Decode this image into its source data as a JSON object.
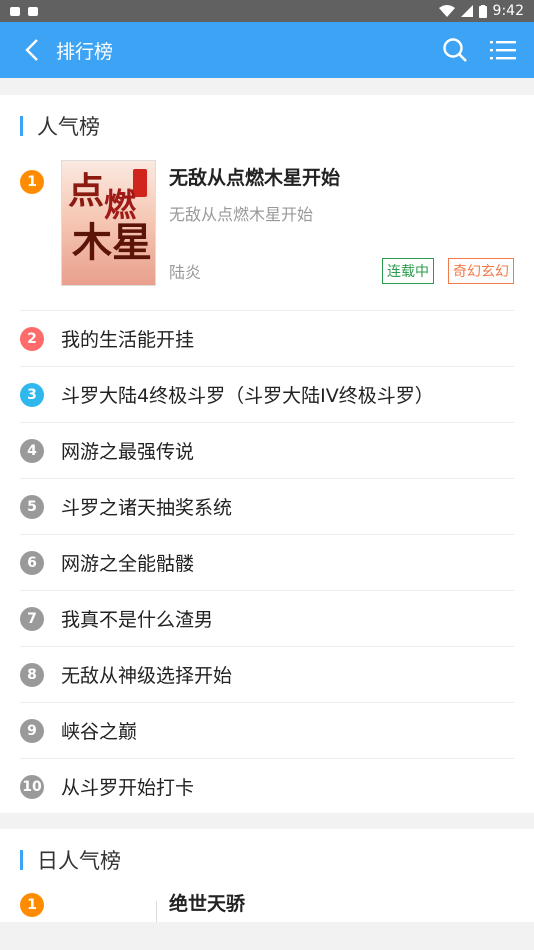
{
  "status": {
    "time": "9:42"
  },
  "appbar": {
    "title": "排行榜"
  },
  "section1": {
    "title": "人气榜",
    "top": {
      "rank": "1",
      "title": "无敌从点燃木星开始",
      "subtitle": "无敌从点燃木星开始",
      "author": "陆炎",
      "status": "连载中",
      "genre": "奇幻玄幻",
      "cover_text": [
        "点",
        "燃",
        "木星"
      ]
    },
    "items": [
      {
        "rank": "2",
        "title": "我的生活能开挂"
      },
      {
        "rank": "3",
        "title": "斗罗大陆4终极斗罗（斗罗大陆IV终极斗罗）"
      },
      {
        "rank": "4",
        "title": "网游之最强传说"
      },
      {
        "rank": "5",
        "title": "斗罗之诸天抽奖系统"
      },
      {
        "rank": "6",
        "title": "网游之全能骷髅"
      },
      {
        "rank": "7",
        "title": "我真不是什么渣男"
      },
      {
        "rank": "8",
        "title": "无敌从神级选择开始"
      },
      {
        "rank": "9",
        "title": "峡谷之巅"
      },
      {
        "rank": "10",
        "title": "从斗罗开始打卡"
      }
    ]
  },
  "section2": {
    "title": "日人气榜",
    "top": {
      "rank": "1",
      "title": "绝世天骄"
    }
  }
}
